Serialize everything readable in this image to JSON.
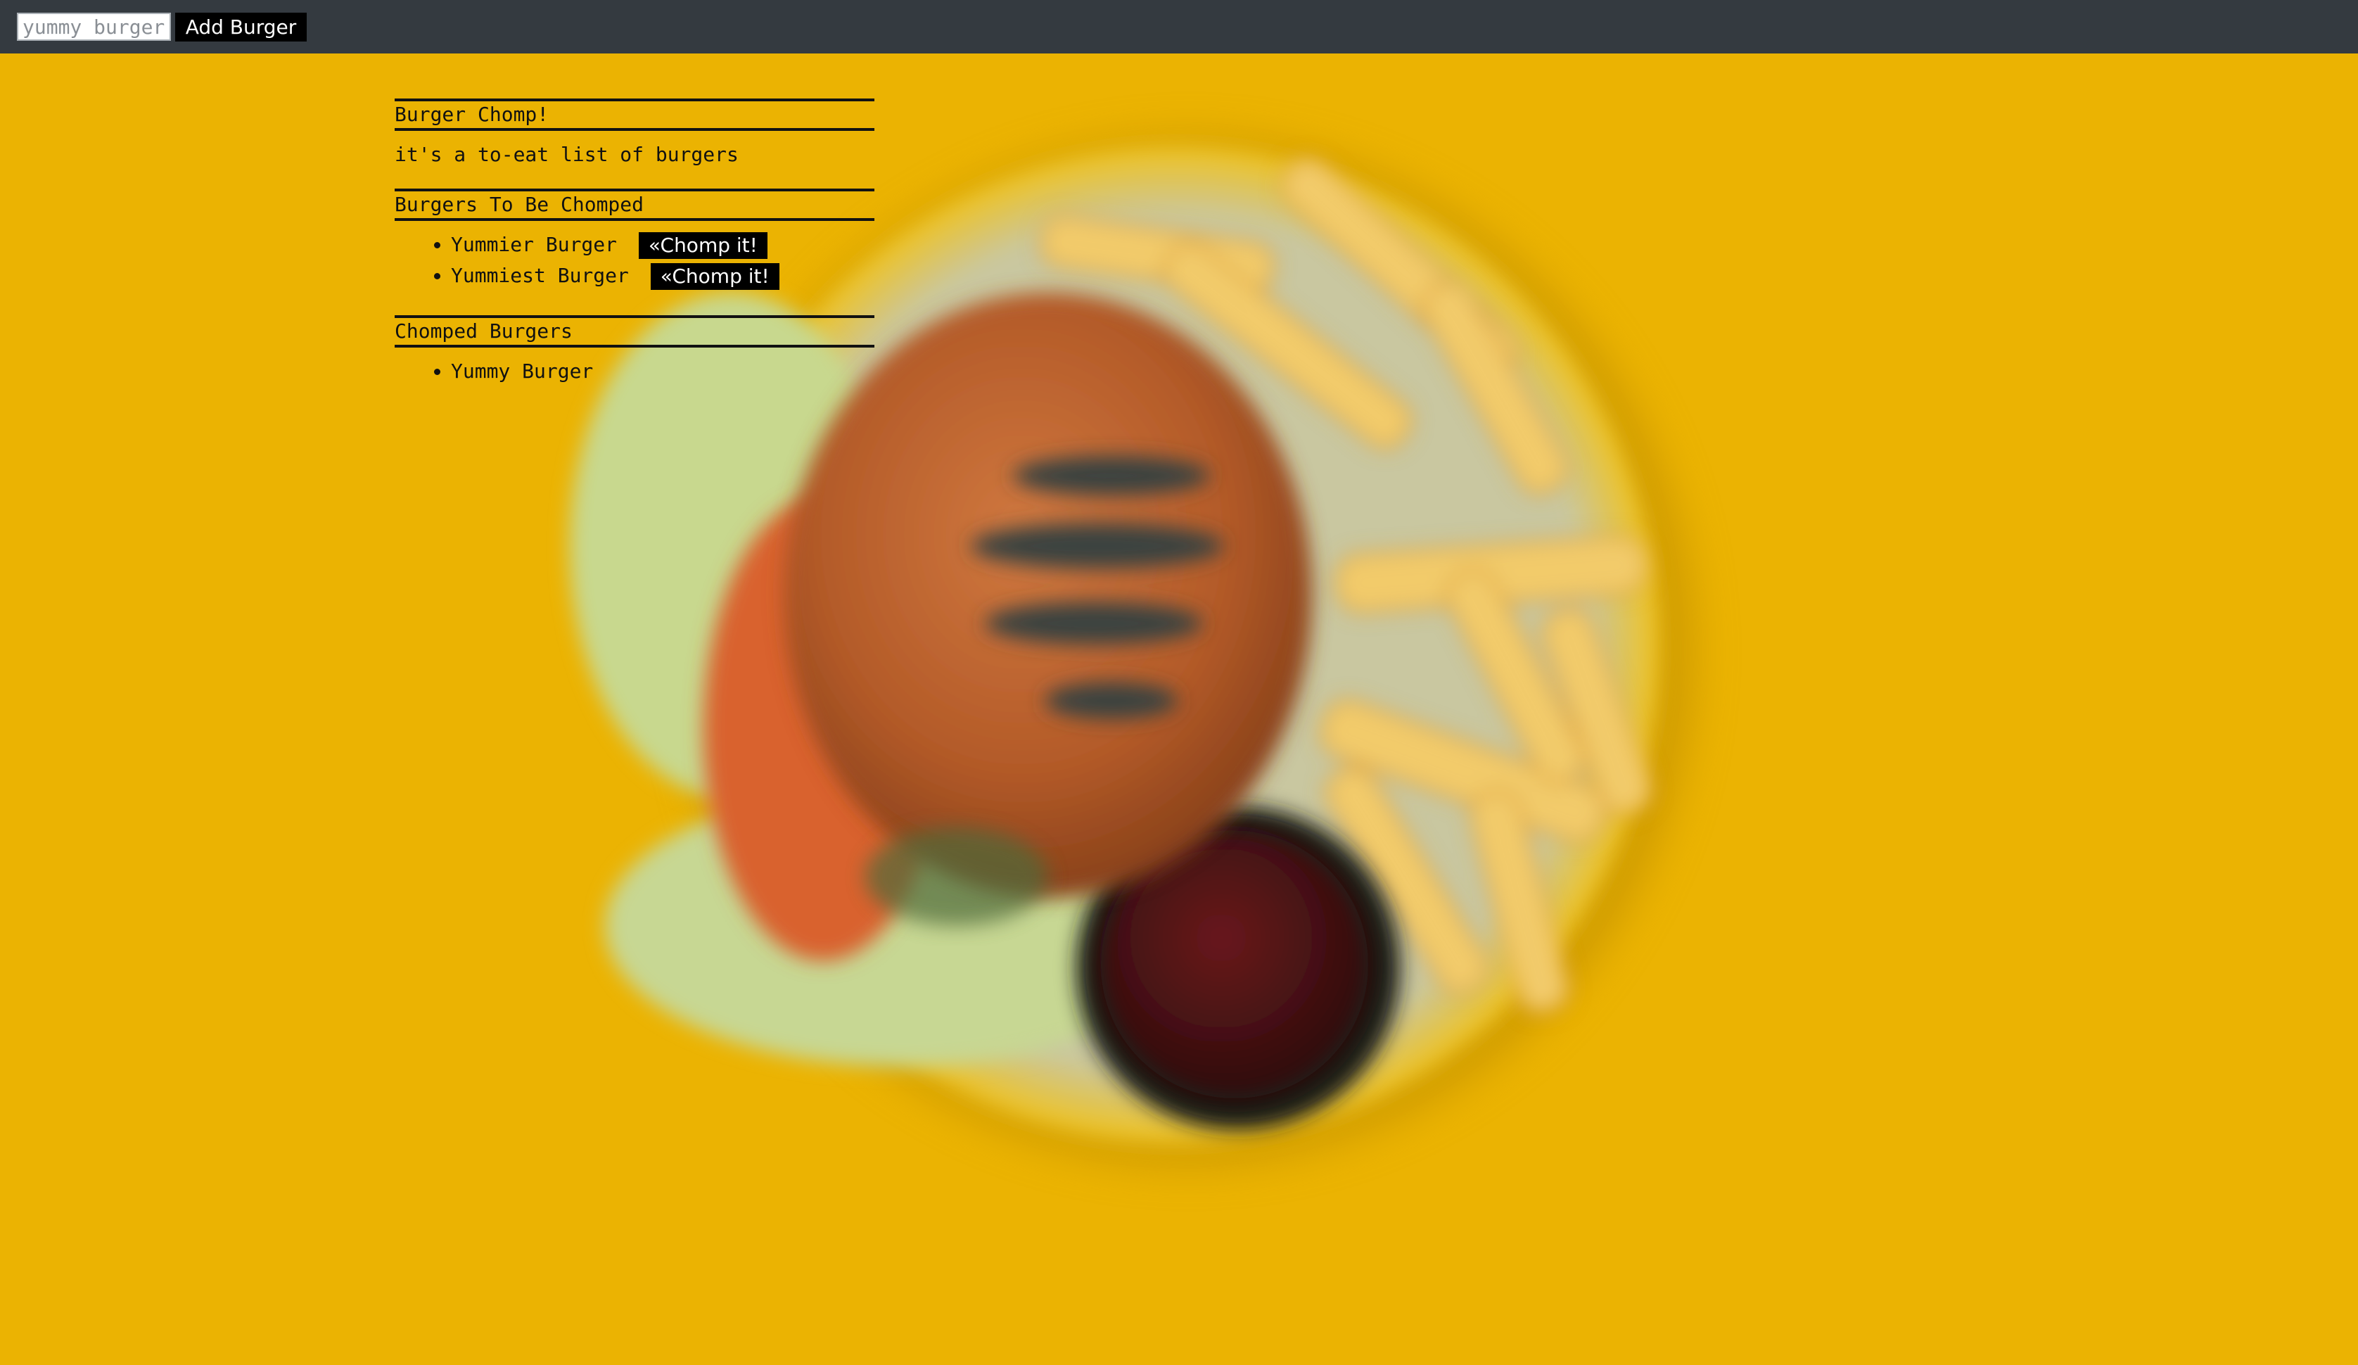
{
  "top_bar": {
    "input_placeholder": "yummy burger",
    "add_button_label": "Add Burger"
  },
  "page": {
    "title": "Burger Chomp!",
    "tagline": "it's a to-eat list of burgers"
  },
  "to_be_chomped": {
    "heading": "Burgers To Be Chomped",
    "items": [
      {
        "name": "Yummier Burger",
        "button_label": "«Chomp it!"
      },
      {
        "name": "Yummiest Burger",
        "button_label": "«Chomp it!"
      }
    ]
  },
  "chomped": {
    "heading": "Chomped Burgers",
    "items": [
      {
        "name": "Yummy Burger"
      }
    ]
  },
  "colors": {
    "background": "#ebb302",
    "top_bar": "#343a40",
    "button": "#000000",
    "text": "#111111"
  },
  "background_image": {
    "icon": "burger-and-fries-photo"
  }
}
